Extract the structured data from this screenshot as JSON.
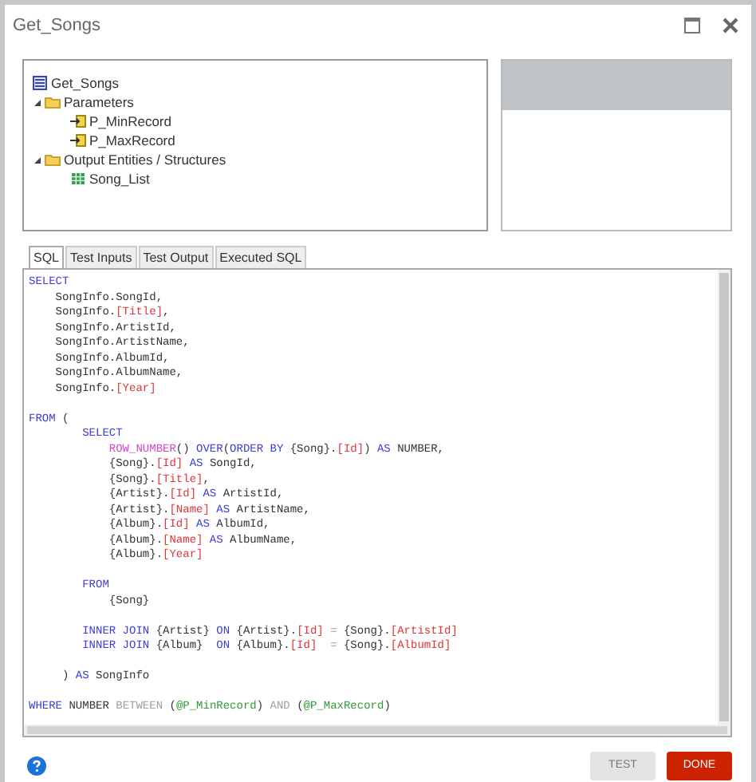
{
  "window": {
    "title": "Get_Songs"
  },
  "tree": [
    {
      "label": "Get_Songs",
      "kind": "procedure",
      "children": [
        {
          "label": "Parameters",
          "kind": "folder",
          "expanded": true,
          "children": [
            {
              "label": "P_MinRecord",
              "kind": "parameter"
            },
            {
              "label": "P_MaxRecord",
              "kind": "parameter"
            }
          ]
        },
        {
          "label": "Output Entities / Structures",
          "kind": "folder",
          "expanded": true,
          "children": [
            {
              "label": "Song_List",
              "kind": "structure"
            }
          ]
        }
      ]
    }
  ],
  "tabs": [
    {
      "label": "SQL",
      "selected": true
    },
    {
      "label": "Test Inputs",
      "selected": false
    },
    {
      "label": "Test Output",
      "selected": false
    },
    {
      "label": "Executed SQL",
      "selected": false
    }
  ],
  "code_blocks": [
    [
      [
        {
          "text": "SELECT",
          "kind": "keyword"
        }
      ],
      [
        {
          "text": "    SongInfo.SongId,",
          "kind": "plain"
        }
      ],
      [
        {
          "text": "    SongInfo.",
          "kind": "plain"
        },
        {
          "text": "[Title]",
          "kind": "bracket"
        },
        {
          "text": ",",
          "kind": "plain"
        }
      ],
      [
        {
          "text": "    SongInfo.ArtistId,",
          "kind": "plain"
        }
      ],
      [
        {
          "text": "    SongInfo.ArtistName,",
          "kind": "plain"
        }
      ],
      [
        {
          "text": "    SongInfo.AlbumId,",
          "kind": "plain"
        }
      ],
      [
        {
          "text": "    SongInfo.AlbumName,",
          "kind": "plain"
        }
      ],
      [
        {
          "text": "    SongInfo.",
          "kind": "plain"
        },
        {
          "text": "[Year]",
          "kind": "bracket"
        }
      ]
    ],
    [
      [
        {
          "text": "FROM",
          "kind": "keyword"
        },
        {
          "text": " (",
          "kind": "plain"
        }
      ],
      [
        {
          "text": "        SELECT",
          "kind": "keyword"
        }
      ],
      [
        {
          "text": "            ROW_NUMBER",
          "kind": "function"
        },
        {
          "text": "() ",
          "kind": "plain"
        },
        {
          "text": "OVER",
          "kind": "keyword"
        },
        {
          "text": "(",
          "kind": "plain"
        },
        {
          "text": "ORDER BY",
          "kind": "keyword"
        },
        {
          "text": " {Song}.",
          "kind": "plain"
        },
        {
          "text": "[Id]",
          "kind": "bracket"
        },
        {
          "text": ") ",
          "kind": "plain"
        },
        {
          "text": "AS",
          "kind": "keyword"
        },
        {
          "text": " NUMBER,",
          "kind": "plain"
        }
      ],
      [
        {
          "text": "            {Song}.",
          "kind": "plain"
        },
        {
          "text": "[Id]",
          "kind": "bracket"
        },
        {
          "text": " AS",
          "kind": "keyword"
        },
        {
          "text": " SongId,",
          "kind": "plain"
        }
      ],
      [
        {
          "text": "            {Song}.",
          "kind": "plain"
        },
        {
          "text": "[Title]",
          "kind": "bracket"
        },
        {
          "text": ",",
          "kind": "plain"
        }
      ],
      [
        {
          "text": "            {Artist}.",
          "kind": "plain"
        },
        {
          "text": "[Id]",
          "kind": "bracket"
        },
        {
          "text": " AS",
          "kind": "keyword"
        },
        {
          "text": " ArtistId,",
          "kind": "plain"
        }
      ],
      [
        {
          "text": "            {Artist}.",
          "kind": "plain"
        },
        {
          "text": "[Name]",
          "kind": "bracket"
        },
        {
          "text": " AS",
          "kind": "keyword"
        },
        {
          "text": " ArtistName,",
          "kind": "plain"
        }
      ],
      [
        {
          "text": "            {Album}.",
          "kind": "plain"
        },
        {
          "text": "[Id]",
          "kind": "bracket"
        },
        {
          "text": " AS",
          "kind": "keyword"
        },
        {
          "text": " AlbumId,",
          "kind": "plain"
        }
      ],
      [
        {
          "text": "            {Album}.",
          "kind": "plain"
        },
        {
          "text": "[Name]",
          "kind": "bracket"
        },
        {
          "text": " AS",
          "kind": "keyword"
        },
        {
          "text": " AlbumName,",
          "kind": "plain"
        }
      ],
      [
        {
          "text": "            {Album}.",
          "kind": "plain"
        },
        {
          "text": "[Year]",
          "kind": "bracket"
        }
      ]
    ],
    [
      [
        {
          "text": "        FROM",
          "kind": "keyword"
        }
      ],
      [
        {
          "text": "            {Song}",
          "kind": "plain"
        }
      ]
    ],
    [
      [
        {
          "text": "        INNER JOIN",
          "kind": "keyword"
        },
        {
          "text": " {Artist} ",
          "kind": "plain"
        },
        {
          "text": "ON",
          "kind": "keyword"
        },
        {
          "text": " {Artist}.",
          "kind": "plain"
        },
        {
          "text": "[Id]",
          "kind": "bracket"
        },
        {
          "text": " =",
          "kind": "operator"
        },
        {
          "text": " {Song}.",
          "kind": "plain"
        },
        {
          "text": "[ArtistId]",
          "kind": "bracket"
        }
      ],
      [
        {
          "text": "        INNER JOIN",
          "kind": "keyword"
        },
        {
          "text": " {Album}  ",
          "kind": "plain"
        },
        {
          "text": "ON",
          "kind": "keyword"
        },
        {
          "text": " {Album}.",
          "kind": "plain"
        },
        {
          "text": "[Id]",
          "kind": "bracket"
        },
        {
          "text": "  =",
          "kind": "operator"
        },
        {
          "text": " {Song}.",
          "kind": "plain"
        },
        {
          "text": "[AlbumId]",
          "kind": "bracket"
        }
      ]
    ],
    [
      [
        {
          "text": "     ) ",
          "kind": "plain"
        },
        {
          "text": "AS",
          "kind": "keyword"
        },
        {
          "text": " SongInfo",
          "kind": "plain"
        }
      ]
    ],
    [
      [
        {
          "text": "WHERE",
          "kind": "keyword"
        },
        {
          "text": " NUMBER ",
          "kind": "plain"
        },
        {
          "text": "BETWEEN",
          "kind": "operator"
        },
        {
          "text": " (",
          "kind": "plain"
        },
        {
          "text": "@P_MinRecord",
          "kind": "param"
        },
        {
          "text": ") ",
          "kind": "plain"
        },
        {
          "text": "AND",
          "kind": "operator"
        },
        {
          "text": " (",
          "kind": "plain"
        },
        {
          "text": "@P_MaxRecord",
          "kind": "param"
        },
        {
          "text": ")",
          "kind": "plain"
        }
      ]
    ]
  ],
  "buttons": [
    {
      "label": "TEST",
      "kind": "secondary"
    },
    {
      "label": "DONE",
      "kind": "primary"
    }
  ]
}
